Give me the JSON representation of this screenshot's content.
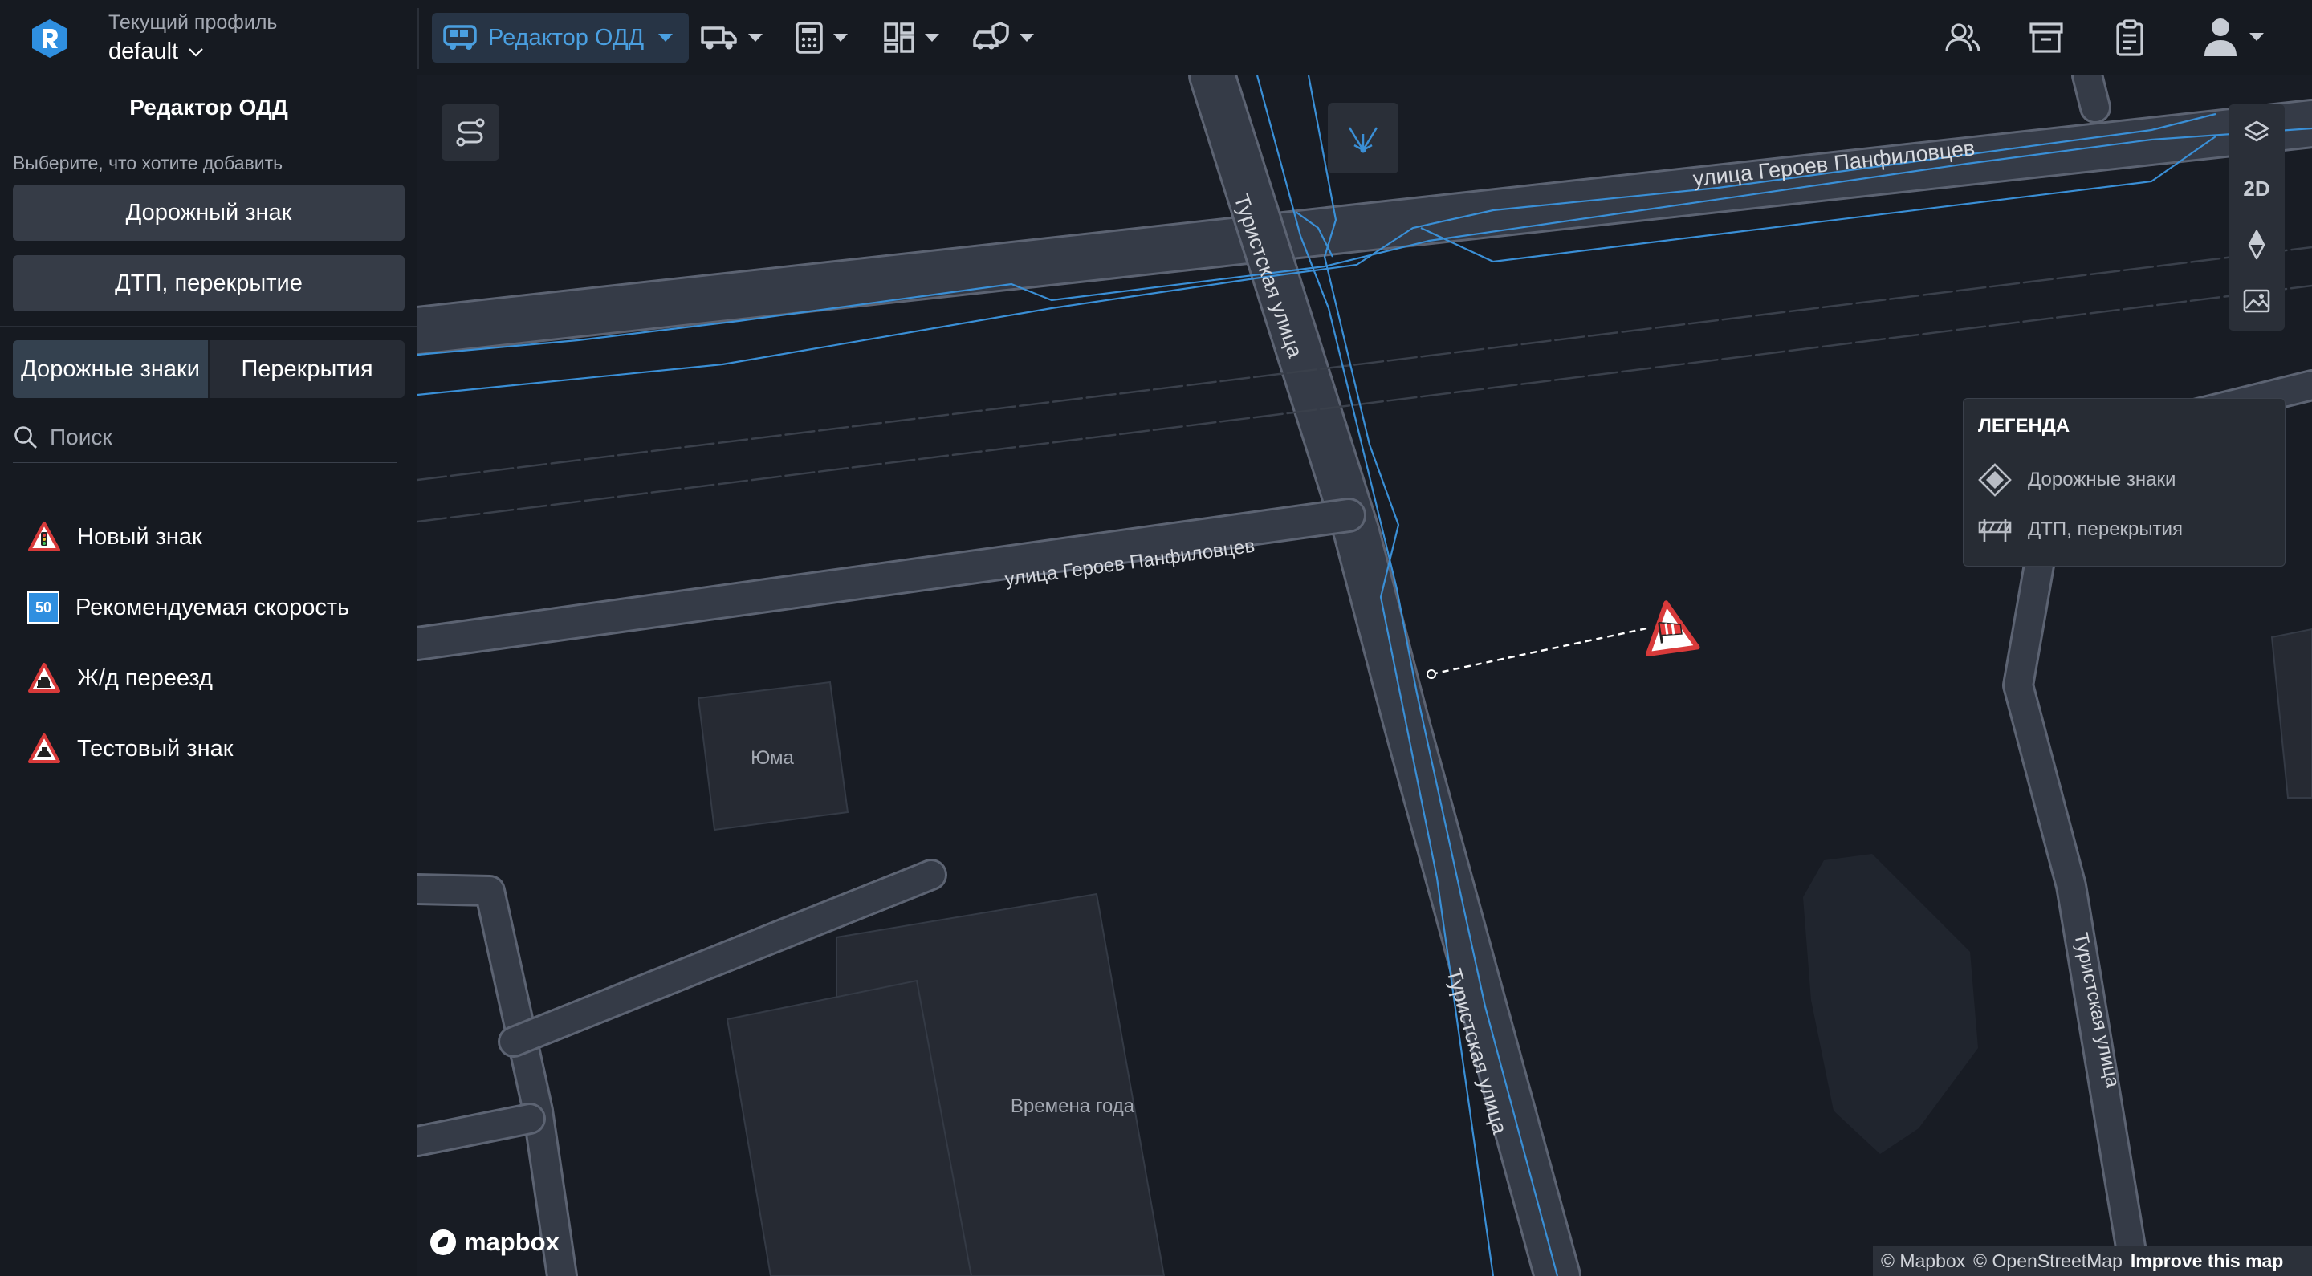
{
  "topbar": {
    "profile_label": "Текущий профиль",
    "profile_value": "default",
    "nav": {
      "odd_editor_label": "Редактор ОДД"
    },
    "icons": [
      "logo-icon",
      "bus-icon",
      "truck-icon",
      "calculator-icon",
      "dashboard-icon",
      "car-shield-icon",
      "users-icon",
      "archive-icon",
      "clipboard-icon",
      "user-avatar-icon"
    ]
  },
  "sidebar": {
    "title": "Редактор ОДД",
    "prompt": "Выберите, что хотите добавить",
    "add_sign_button": "Дорожный знак",
    "add_incident_button": "ДТП, перекрытие",
    "tabs": [
      {
        "label": "Дорожные знаки",
        "active": true
      },
      {
        "label": "Перекрытия",
        "active": false
      }
    ],
    "search": {
      "placeholder": "Поиск"
    },
    "signs": [
      {
        "label": "Новый знак",
        "icon": "warning-traffic-light-sign-icon"
      },
      {
        "label": "Рекомендуемая скорость",
        "icon": "speed-50-sign-icon",
        "icon_text": "50"
      },
      {
        "label": "Ж/д переезд",
        "icon": "railway-crossing-sign-icon"
      },
      {
        "label": "Тестовый знак",
        "icon": "test-warning-sign-icon"
      }
    ]
  },
  "map": {
    "street_labels": {
      "heroes_top": "улица Героев Панфиловцев",
      "heroes_mid": "улица Героев Панфиловцев",
      "turist_upper": "Туристская улица",
      "turist_lower": "Туристская улица",
      "turist_right": "Туристская улица"
    },
    "building_labels": {
      "yuma": "Юма",
      "vremena_goda": "Времена года"
    },
    "controls": {
      "mode_2d": "2D"
    },
    "legend": {
      "title": "ЛЕГЕНДА",
      "items": [
        {
          "label": "Дорожные знаки",
          "icon": "road-sign-diamond-icon"
        },
        {
          "label": "ДТП, перекрытия",
          "icon": "barrier-icon"
        }
      ]
    },
    "mapbox_logo": "mapbox",
    "attribution": {
      "mapbox": "© Mapbox",
      "osm": "© OpenStreetMap",
      "improve": "Improve this map"
    }
  },
  "colors": {
    "accent": "#4a9fe0",
    "background": "#161a21",
    "map_bg": "#181c24",
    "road_fill": "#353b47",
    "road_edge": "#5a6170",
    "route_line": "#3a8fd6",
    "sign_red": "#d83a3a"
  }
}
